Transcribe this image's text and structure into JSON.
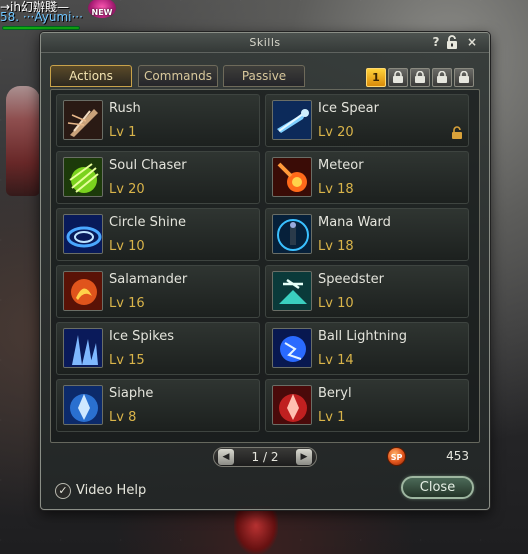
{
  "player": {
    "name_line": "58. ···Ayumi···",
    "top_text": "→ih幻辦賤—",
    "new_badge": "NEW"
  },
  "window": {
    "title": "Skills",
    "help_label": "?",
    "lock_label": "🔓",
    "close_label": "×"
  },
  "tabs": [
    {
      "label": "Actions",
      "active": true
    },
    {
      "label": "Commands",
      "active": false
    },
    {
      "label": "Passive",
      "active": false
    }
  ],
  "page_tabs": [
    "1",
    "",
    "",
    "",
    ""
  ],
  "skills": [
    {
      "name": "Rush",
      "level": "Lv 1",
      "icon": "rush-icon"
    },
    {
      "name": "Ice Spear",
      "level": "Lv 20",
      "icon": "ice-spear-icon",
      "locked": true
    },
    {
      "name": "Soul Chaser",
      "level": "Lv 20",
      "icon": "soul-chaser-icon"
    },
    {
      "name": "Meteor",
      "level": "Lv 18",
      "icon": "meteor-icon"
    },
    {
      "name": "Circle Shine",
      "level": "Lv 10",
      "icon": "circle-shine-icon"
    },
    {
      "name": "Mana Ward",
      "level": "Lv 18",
      "icon": "mana-ward-icon"
    },
    {
      "name": "Salamander",
      "level": "Lv 16",
      "icon": "salamander-icon"
    },
    {
      "name": "Speedster",
      "level": "Lv 10",
      "icon": "speedster-icon"
    },
    {
      "name": "Ice Spikes",
      "level": "Lv 15",
      "icon": "ice-spikes-icon"
    },
    {
      "name": "Ball Lightning",
      "level": "Lv 14",
      "icon": "ball-lightning-icon"
    },
    {
      "name": "Siaphe",
      "level": "Lv 8",
      "icon": "siaphe-icon"
    },
    {
      "name": "Beryl",
      "level": "Lv 1",
      "icon": "beryl-icon"
    }
  ],
  "pagination": {
    "text": "1 / 2",
    "prev": "◀",
    "next": "▶"
  },
  "skill_points": {
    "icon_text": "SP",
    "value": "453"
  },
  "footer": {
    "video_help_label": "Video Help",
    "video_help_check": "✓",
    "close_label": "Close"
  }
}
